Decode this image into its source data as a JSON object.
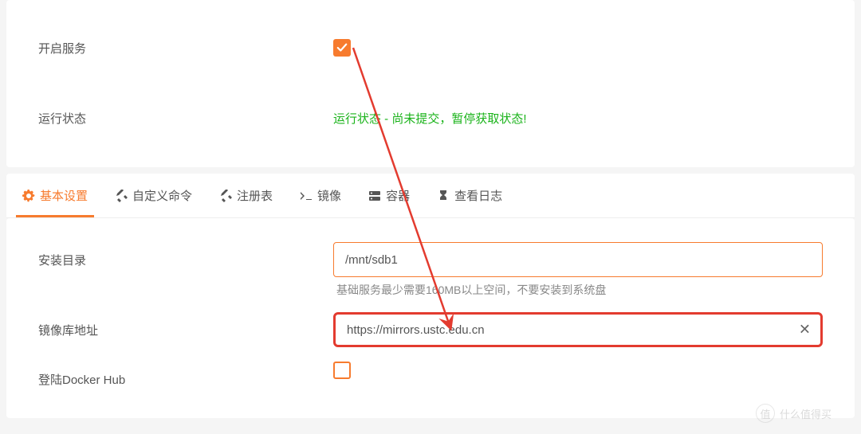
{
  "service": {
    "enable_label": "开启服务",
    "status_label": "运行状态",
    "status_text": "运行状态 - 尚未提交，暂停获取状态!"
  },
  "tabs": [
    {
      "label": "基本设置",
      "icon": "gear"
    },
    {
      "label": "自定义命令",
      "icon": "tools"
    },
    {
      "label": "注册表",
      "icon": "tools"
    },
    {
      "label": "镜像",
      "icon": "terminal"
    },
    {
      "label": "容器",
      "icon": "server"
    },
    {
      "label": "查看日志",
      "icon": "hourglass"
    }
  ],
  "form": {
    "install_dir_label": "安装目录",
    "install_dir_value": "/mnt/sdb1",
    "install_dir_help": "基础服务最少需要160MB以上空间，不要安装到系统盘",
    "mirror_label": "镜像库地址",
    "mirror_value": "https://mirrors.ustc.edu.cn",
    "docker_hub_label": "登陆Docker Hub"
  },
  "watermark": {
    "circle": "值",
    "text": "什么值得买"
  }
}
